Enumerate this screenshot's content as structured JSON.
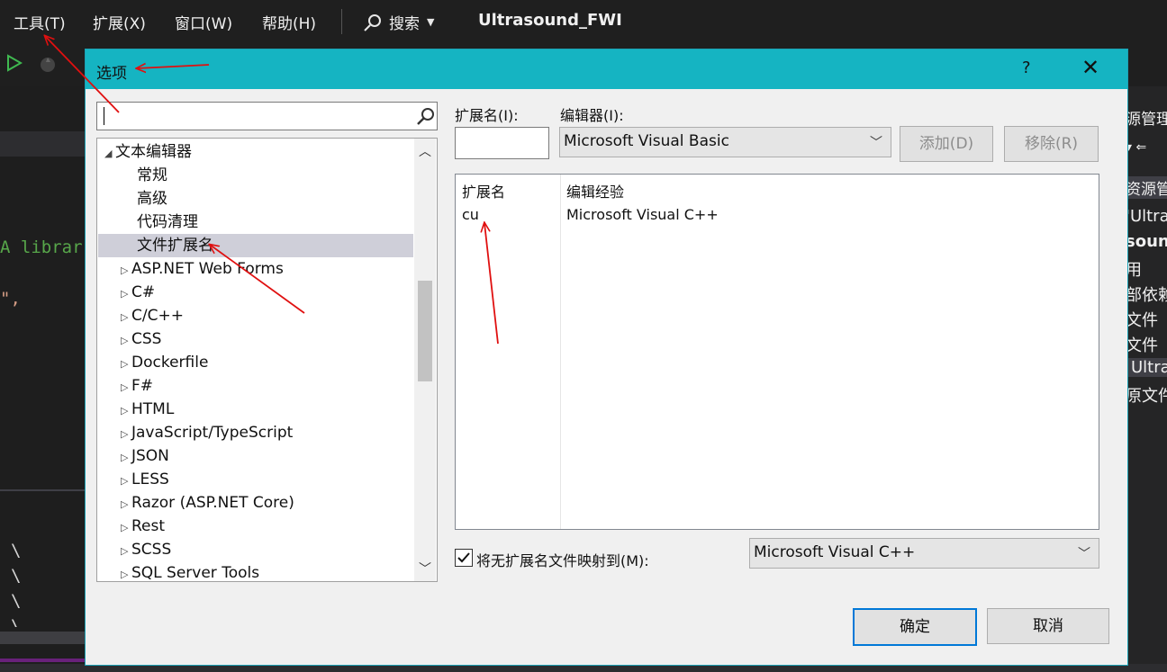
{
  "menubar": {
    "items": [
      "工具(T)",
      "扩展(X)",
      "窗口(W)",
      "帮助(H)"
    ],
    "search_label": "搜索",
    "title": "Ultrasound_FWI"
  },
  "editor_code": {
    "line1": "A librar",
    "line2": "\",",
    "backslashes": [
      "\\",
      "\\",
      "\\",
      "\\"
    ]
  },
  "right_pane": {
    "items": [
      "源管理器",
      "资源管理",
      "'Ultra",
      "sound",
      "用",
      "部依赖",
      "文件",
      "文件",
      "Ultra",
      "原文件"
    ]
  },
  "dialog": {
    "title": "选项",
    "help": "?",
    "close": "✕",
    "search": {
      "value": "",
      "placeholder": ""
    },
    "tree": {
      "parent": "文本编辑器",
      "children": [
        "常规",
        "高级",
        "代码清理",
        "文件扩展名"
      ],
      "selected": "文件扩展名",
      "groups": [
        "ASP.NET Web Forms",
        "C#",
        "C/C++",
        "CSS",
        "Dockerfile",
        "F#",
        "HTML",
        "JavaScript/TypeScript",
        "JSON",
        "LESS",
        "Razor (ASP.NET Core)",
        "Rest",
        "SCSS",
        "SQL Server Tools"
      ]
    },
    "extension_label": "扩展名(I):",
    "extension_value": "",
    "editor_label": "编辑器(I):",
    "editor_value": "Microsoft Visual Basic",
    "add_button": "添加(D)",
    "remove_button": "移除(R)",
    "list": {
      "headers": [
        "扩展名",
        "编辑经验"
      ],
      "rows": [
        [
          "cu",
          "Microsoft Visual C++"
        ]
      ]
    },
    "map_checkbox_label": "将无扩展名文件映射到(M):",
    "map_checked": true,
    "map_value": "Microsoft Visual C++",
    "ok_button": "确定",
    "cancel_button": "取消"
  },
  "colors": {
    "dialog_title_bar": "#15b4c2",
    "selection": "#cfcfd9",
    "annotation_arrow": "#e01010"
  }
}
